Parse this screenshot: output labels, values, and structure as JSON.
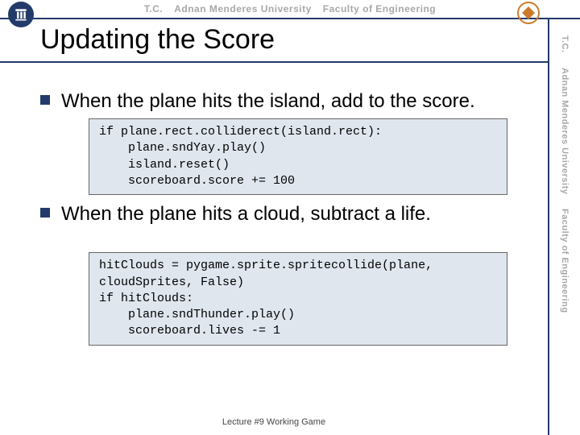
{
  "header": {
    "tc": "T.C.",
    "univ": "Adnan Menderes University",
    "fac": "Faculty of Engineering"
  },
  "side": {
    "tc": "T.C.",
    "univ": "Adnan Menderes University",
    "fac": "Faculty of Engineering"
  },
  "title": "Updating the Score",
  "bullets": {
    "b1": "When the plane hits the island, add to the score.",
    "b2": "When the plane hits a cloud, subtract a life."
  },
  "code": {
    "c1": "if plane.rect.colliderect(island.rect):\n    plane.sndYay.play()\n    island.reset()\n    scoreboard.score += 100",
    "c2": "hitClouds = pygame.sprite.spritecollide(plane,\ncloudSprites, False)\nif hitClouds:\n    plane.sndThunder.play()\n    scoreboard.lives -= 1"
  },
  "footer": "Lecture #9 Working Game"
}
